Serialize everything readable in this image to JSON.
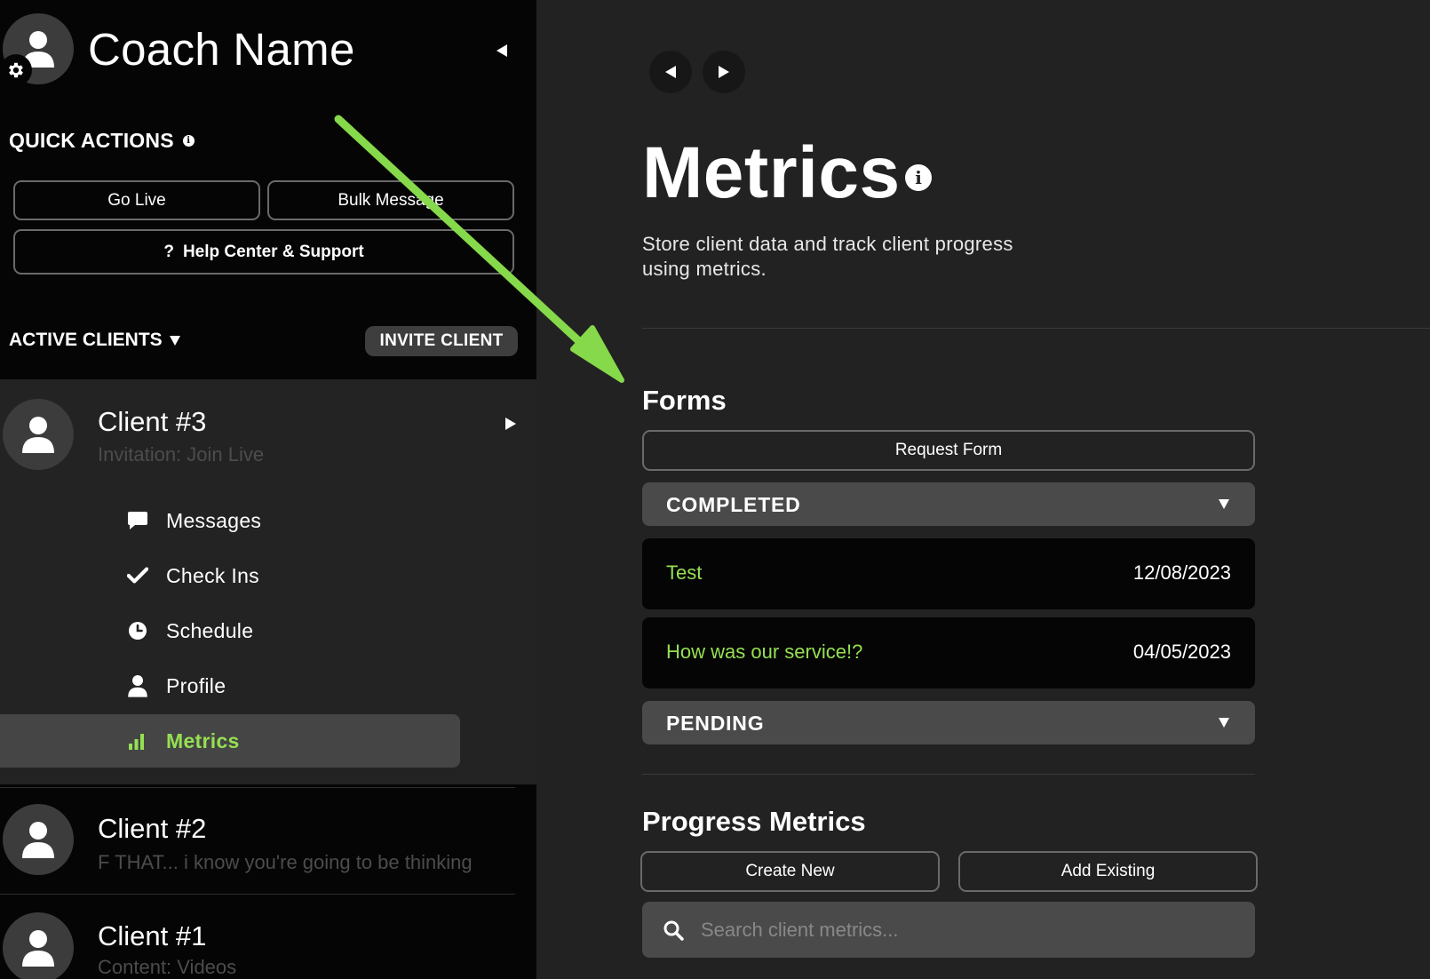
{
  "sidebar": {
    "coach_name": "Coach Name",
    "quick_actions_label": "QUICK ACTIONS",
    "quick_actions_info": "i",
    "go_live_label": "Go Live",
    "bulk_message_label": "Bulk Message",
    "help_center_icon": "?",
    "help_center_label": "Help Center & Support",
    "active_clients_label": "ACTIVE CLIENTS",
    "invite_client_label": "INVITE CLIENT",
    "clients": [
      {
        "name": "Client #3",
        "subtitle": "Invitation: Join Live"
      },
      {
        "name": "Client #2",
        "subtitle": "F THAT... i know you're going to be thinking"
      },
      {
        "name": "Client #1",
        "subtitle": "Content: Videos"
      }
    ],
    "client_nav": [
      {
        "label": "Messages",
        "icon": "chat-bubble-icon"
      },
      {
        "label": "Check Ins",
        "icon": "checkmark-icon"
      },
      {
        "label": "Schedule",
        "icon": "clock-icon"
      },
      {
        "label": "Profile",
        "icon": "person-icon"
      },
      {
        "label": "Metrics",
        "icon": "bar-chart-icon",
        "active": true
      }
    ]
  },
  "main": {
    "title": "Metrics",
    "title_info": "i",
    "description": "Store client data and track client progress using metrics.",
    "forms": {
      "heading": "Forms",
      "request_form_label": "Request Form",
      "completed_label": "COMPLETED",
      "completed_items": [
        {
          "name": "Test",
          "date": "12/08/2023"
        },
        {
          "name": "How was our service!?",
          "date": "04/05/2023"
        }
      ],
      "pending_label": "PENDING"
    },
    "progress_metrics": {
      "heading": "Progress Metrics",
      "create_new_label": "Create New",
      "add_existing_label": "Add Existing",
      "search_placeholder": "Search client metrics..."
    }
  },
  "colors": {
    "accent": "#95e052",
    "sidebar_bg": "#050505",
    "main_bg": "#222222",
    "panel_bg": "#232323",
    "accordion_bg": "#4a4a4a",
    "annotation_arrow": "#86d94a"
  }
}
